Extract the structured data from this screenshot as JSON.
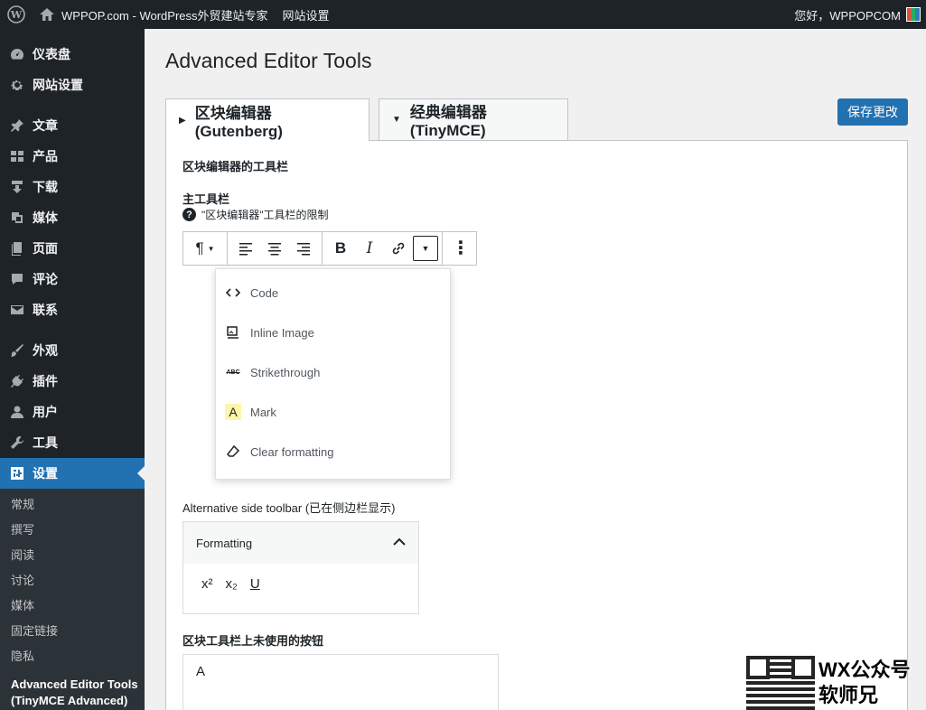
{
  "adminbar": {
    "site_name": "WPPOP.com - WordPress外贸建站专家",
    "menu_link": "网站设置",
    "greeting": "您好，WPPOPCOM"
  },
  "sidebar": {
    "items": [
      {
        "label": "仪表盘",
        "icon": "dashboard-icon"
      },
      {
        "label": "网站设置",
        "icon": "gear-icon"
      },
      {
        "label": "文章",
        "icon": "pin-icon"
      },
      {
        "label": "产品",
        "icon": "grid-icon"
      },
      {
        "label": "下载",
        "icon": "download-icon"
      },
      {
        "label": "媒体",
        "icon": "media-icon"
      },
      {
        "label": "页面",
        "icon": "page-icon"
      },
      {
        "label": "评论",
        "icon": "comment-icon"
      },
      {
        "label": "联系",
        "icon": "mail-icon"
      },
      {
        "label": "外观",
        "icon": "brush-icon"
      },
      {
        "label": "插件",
        "icon": "plugin-icon"
      },
      {
        "label": "用户",
        "icon": "user-icon"
      },
      {
        "label": "工具",
        "icon": "wrench-icon"
      },
      {
        "label": "设置",
        "icon": "settings-icon"
      }
    ],
    "submenu": [
      "常规",
      "撰写",
      "阅读",
      "讨论",
      "媒体",
      "固定链接",
      "隐私"
    ],
    "submenu_active": "Advanced Editor Tools (TinyMCE Advanced)"
  },
  "main": {
    "title": "Advanced Editor Tools",
    "save_label": "保存更改",
    "tabs": [
      {
        "label": "区块编辑器(Gutenberg)",
        "active": true
      },
      {
        "label": "经典编辑器(TinyMCE)",
        "active": false
      }
    ],
    "section_title": "区块编辑器的工具栏",
    "main_toolbar_label": "主工具栏",
    "toolbar_note": "\"区块编辑器\"工具栏的限制",
    "dropdown_items": [
      {
        "label": "Code",
        "icon": "code-icon"
      },
      {
        "label": "Inline Image",
        "icon": "inline-image-icon"
      },
      {
        "label": "Strikethrough",
        "icon": "strikethrough-icon"
      },
      {
        "label": "Mark",
        "icon": "mark-icon"
      },
      {
        "label": "Clear formatting",
        "icon": "eraser-icon"
      }
    ],
    "side_toolbar_label": "Alternative side toolbar (已在侧边栏显示)",
    "side_panel_title": "Formatting",
    "side_buttons": [
      "x²",
      "x₂",
      "U"
    ],
    "unused_label": "区块工具栏上未使用的按钮",
    "unused_value": "A"
  },
  "watermark": {
    "line1": "WX公众号",
    "line2": "软师兄"
  }
}
